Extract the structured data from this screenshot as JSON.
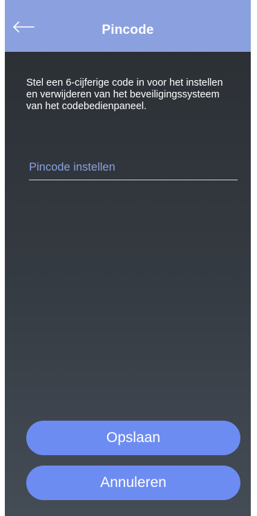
{
  "header": {
    "title": "Pincode",
    "back_icon": "arrow-left-icon"
  },
  "description": "Stel een 6-cijferige code in voor het instellen en verwijderen van het beveiligingssysteem van het codebedienpaneel.",
  "pin_field": {
    "placeholder": "Pincode instellen",
    "value": ""
  },
  "buttons": {
    "save_label": "Opslaan",
    "cancel_label": "Annuleren"
  },
  "colors": {
    "header_background": "#8ba1df",
    "button_background": "#6d8cf2",
    "placeholder": "#8ba1df"
  }
}
